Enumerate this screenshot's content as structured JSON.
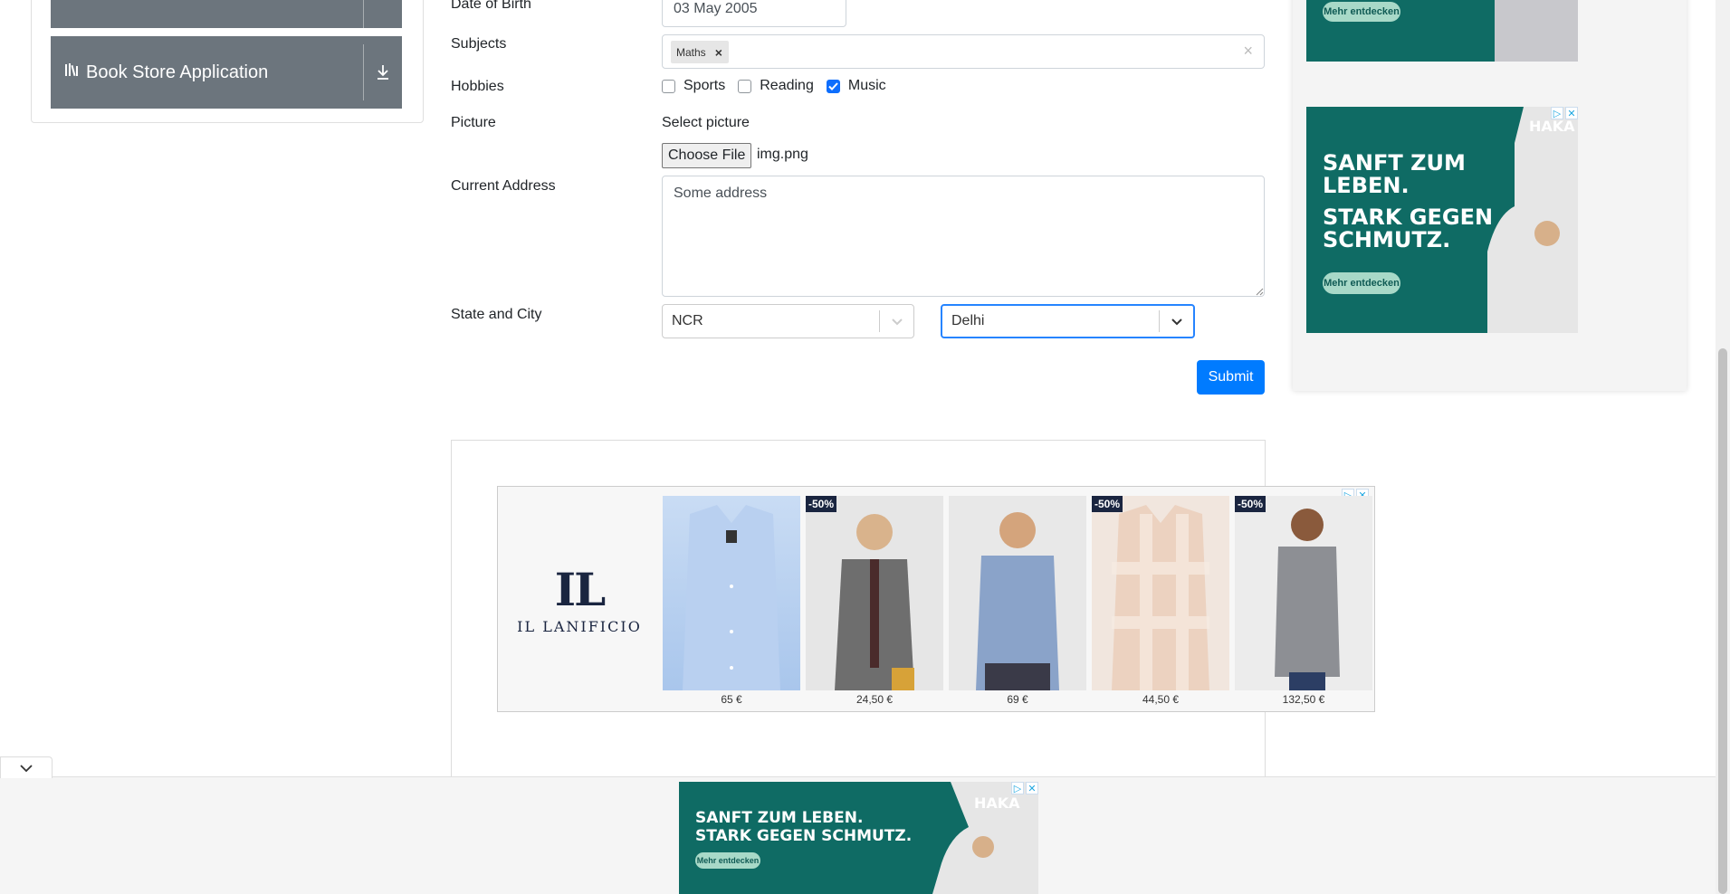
{
  "sidebar": {
    "book_store": "Book Store Application"
  },
  "form": {
    "dob_label": "Date of Birth",
    "dob_value": "03 May 2005",
    "subjects_label": "Subjects",
    "subjects_tag": "Maths",
    "hobbies_label": "Hobbies",
    "hobbies": [
      {
        "label": "Sports",
        "checked": false
      },
      {
        "label": "Reading",
        "checked": false
      },
      {
        "label": "Music",
        "checked": true
      }
    ],
    "picture_label": "Picture",
    "select_picture": "Select picture",
    "choose_file": "Choose File",
    "file_name": "img.png",
    "address_label": "Current Address",
    "address_value": "Some address",
    "state_city_label": "State and City",
    "state_value": "NCR",
    "city_value": "Delhi",
    "submit_label": "Submit"
  },
  "ads": {
    "haka_cta": "Mehr entdecken",
    "haka_line1": "SANFT ZUM",
    "haka_line2": "LEBEN.",
    "haka_line3": "STARK GEGEN",
    "haka_line4": "SCHMUTZ.",
    "haka_brand": "HAKA",
    "haka_banner_line1": "SANFT ZUM LEBEN.",
    "haka_banner_line2": "STARK GEGEN SCHMUTZ.",
    "lanificio_mark": "IL",
    "lanificio_name": "IL LANIFICIO",
    "products": [
      {
        "price": "65 €",
        "badge": ""
      },
      {
        "price": "24,50 €",
        "badge": "-50%"
      },
      {
        "price": "69 €",
        "badge": ""
      },
      {
        "price": "44,50 €",
        "badge": "-50%"
      },
      {
        "price": "132,50 €",
        "badge": "-50%"
      }
    ]
  },
  "colors": {
    "primary": "#007bff",
    "sidebar_btn": "#6c757d",
    "haka": "#0f6b64"
  }
}
